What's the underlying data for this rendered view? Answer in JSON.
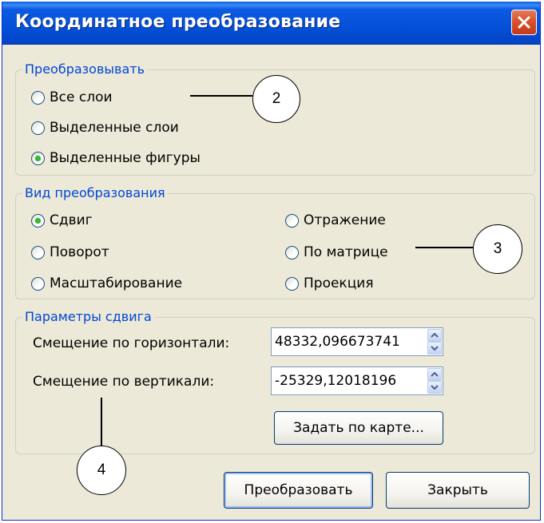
{
  "window": {
    "title": "Координатное преобразование"
  },
  "transform_group": {
    "label": "Преобразовывать",
    "options": [
      "Все слои",
      "Выделенные слои",
      "Выделенные фигуры"
    ],
    "selected": "Выделенные фигуры"
  },
  "type_group": {
    "label": "Вид преобразования",
    "options_left": [
      "Сдвиг",
      "Поворот",
      "Масштабирование"
    ],
    "options_right": [
      "Отражение",
      "По матрице",
      "Проекция"
    ],
    "selected": "Сдвиг"
  },
  "shift_group": {
    "label": "Параметры сдвига",
    "horizontal_label": "Смещение по горизонтали:",
    "horizontal_value": "48332,096673741",
    "vertical_label": "Смещение по вертикали:",
    "vertical_value": "-25329,12018196",
    "map_button": "Задать по карте..."
  },
  "buttons": {
    "transform": "Преобразовать",
    "close": "Закрыть"
  },
  "callouts": [
    "2",
    "3",
    "4"
  ],
  "colors": {
    "titlebar": "#0450d8",
    "group_label": "#0046d5",
    "radio_selected": "#2fbe2f",
    "window_bg": "#ece9d8"
  }
}
